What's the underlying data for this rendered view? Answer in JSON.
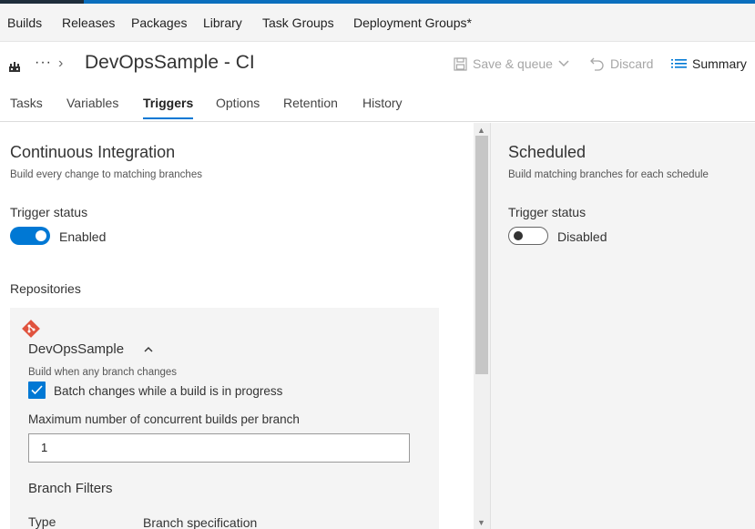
{
  "nav": {
    "items": [
      "Builds",
      "Releases",
      "Packages",
      "Library",
      "Task Groups",
      "Deployment Groups*"
    ]
  },
  "header": {
    "more": "···",
    "title": "DevOpsSample - CI",
    "save_queue": "Save & queue",
    "discard": "Discard",
    "summary": "Summary",
    "icons": [
      "build-pipeline-icon",
      "chevron-right-icon",
      "save-icon",
      "chevron-down-icon",
      "undo-icon",
      "list-icon"
    ]
  },
  "tabs": [
    "Tasks",
    "Variables",
    "Triggers",
    "Options",
    "Retention",
    "History"
  ],
  "active_tab": "Triggers",
  "ci": {
    "title": "Continuous Integration",
    "subtitle": "Build every change to matching branches",
    "trigger_label": "Trigger status",
    "trigger_value": "Enabled",
    "repositories_label": "Repositories",
    "repo": {
      "name": "DevOpsSample",
      "description": "Build when any branch changes",
      "batch_label": "Batch changes while a build is in progress",
      "batch_checked": true,
      "max_builds_label": "Maximum number of concurrent builds per branch",
      "max_builds_value": "1",
      "branch_filters_label": "Branch Filters",
      "col_type": "Type",
      "col_spec": "Branch specification"
    }
  },
  "scheduled": {
    "title": "Scheduled",
    "subtitle": "Build matching branches for each schedule",
    "trigger_label": "Trigger status",
    "trigger_value": "Disabled"
  },
  "colors": {
    "accent": "#0078d4",
    "git": "#e0533e"
  }
}
